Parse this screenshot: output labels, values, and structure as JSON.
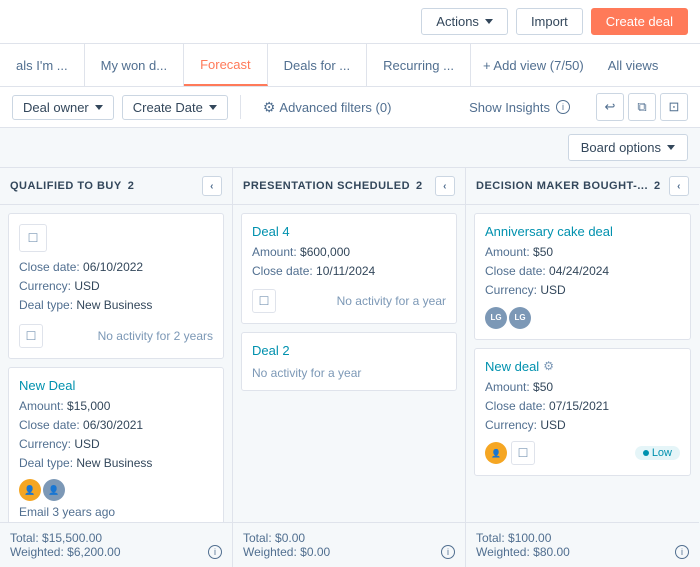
{
  "topBar": {
    "actionsLabel": "Actions",
    "importLabel": "Import",
    "createDealLabel": "Create deal"
  },
  "tabs": [
    {
      "label": "als I'm ...",
      "active": false
    },
    {
      "label": "My won d...",
      "active": false
    },
    {
      "label": "Forecast",
      "active": true
    },
    {
      "label": "Deals for ...",
      "active": false
    },
    {
      "label": "Recurring ...",
      "active": false
    }
  ],
  "tabAdd": "+ Add view (7/50)",
  "tabAllViews": "All views",
  "filterBar": {
    "dealOwner": "Deal owner",
    "createDate": "Create Date",
    "advancedFilters": "Advanced filters (0)",
    "showInsights": "Show Insights"
  },
  "boardOptionsBar": {
    "boardOptions": "Board options"
  },
  "columns": [
    {
      "title": "QUALIFIED TO BUY",
      "count": 2,
      "cards": [
        {
          "title": null,
          "metaLines": [
            "Close date: 06/10/2022",
            "Currency: USD",
            "Deal type: New Business"
          ],
          "activityText": "No activity for 2 years",
          "hasActivityIcon": true
        },
        {
          "title": "New Deal",
          "metaLines": [
            "Amount: $15,000",
            "Close date: 06/30/2021",
            "Currency: USD",
            "Deal type: New Business"
          ],
          "emailActivity": "Email 3 years ago",
          "hasAvatars": true,
          "avatarColors": [
            "#f5a623",
            "#7c98b6"
          ]
        }
      ],
      "footer": {
        "total": "Total: $15,500.00",
        "weighted": "Weighted: $6,200.00"
      }
    },
    {
      "title": "PRESENTATION SCHEDULED",
      "count": 2,
      "cards": [
        {
          "title": "Deal 4",
          "metaLines": [
            "Amount: $600,000",
            "Close date: 10/11/2024"
          ],
          "activityText": "No activity for a year",
          "hasActivityIcon": true
        },
        {
          "title": "Deal 2",
          "metaLines": [],
          "activityText": "No activity for a year",
          "hasActivityIcon": false
        }
      ],
      "footer": {
        "total": "Total: $0.00",
        "weighted": "Weighted: $0.00"
      }
    },
    {
      "title": "DECISION MAKER BOUGHT-...",
      "count": 2,
      "cards": [
        {
          "title": "Anniversary cake deal",
          "metaLines": [
            "Amount: $50",
            "Close date: 04/24/2024",
            "Currency: USD"
          ],
          "hasAvatarPair": true,
          "avatarPair": [
            "LG",
            "LG"
          ],
          "avatarColors": [
            "#7c98b6",
            "#7c98b6"
          ]
        },
        {
          "title": "New deal",
          "hasSettingsIcon": true,
          "metaLines": [
            "Amount: $50",
            "Close date: 07/15/2021",
            "Currency: USD"
          ],
          "hasAvatar2": true,
          "lowBadge": "Low"
        }
      ],
      "footer": {
        "total": "Total: $100.00",
        "weighted": "Weighted: $80.00"
      }
    }
  ]
}
